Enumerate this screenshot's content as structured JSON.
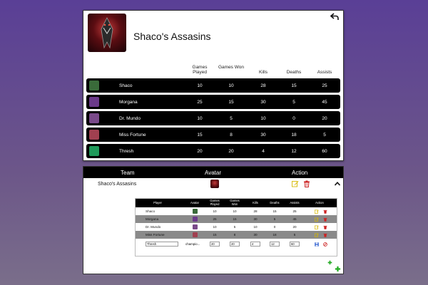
{
  "team": {
    "name": "Shaco's Assasins",
    "stat_headers": {
      "games_played": "Games Played",
      "games_won": "Games Won",
      "kills": "Kills",
      "deaths": "Deaths",
      "assists": "Assists"
    },
    "players": [
      {
        "name": "Shaco",
        "played": "10",
        "won": "10",
        "kills": "28",
        "deaths": "15",
        "assists": "25",
        "color": "#3a6b3a"
      },
      {
        "name": "Morgana",
        "played": "25",
        "won": "15",
        "kills": "30",
        "deaths": "5",
        "assists": "45",
        "color": "#6b3a8a"
      },
      {
        "name": "Dr. Mundo",
        "played": "10",
        "won": "5",
        "kills": "10",
        "deaths": "0",
        "assists": "20",
        "color": "#7a4a8a"
      },
      {
        "name": "Miss Fortune",
        "played": "15",
        "won": "8",
        "kills": "30",
        "deaths": "18",
        "assists": "5",
        "color": "#a04050"
      },
      {
        "name": "Thresh",
        "played": "20",
        "won": "20",
        "kills": "4",
        "deaths": "12",
        "assists": "60",
        "color": "#1f9a5a"
      }
    ]
  },
  "admin": {
    "headers": {
      "team": "Team",
      "avatar": "Avatar",
      "action": "Action"
    },
    "team_name": "Shaco's Assasins",
    "inner_headers": {
      "player": "Player",
      "avatar": "Avatar",
      "games_played": "Games Played",
      "games_won": "Games Won",
      "kills": "Kills",
      "deaths": "Deaths",
      "assists": "Assists",
      "action": "Action"
    },
    "rows": [
      {
        "name": "Shaco",
        "played": "10",
        "won": "10",
        "kills": "28",
        "deaths": "15",
        "assists": "25"
      },
      {
        "name": "Morgana",
        "played": "25",
        "won": "15",
        "kills": "30",
        "deaths": "5",
        "assists": "45"
      },
      {
        "name": "Dr. Mundo",
        "played": "10",
        "won": "5",
        "kills": "10",
        "deaths": "0",
        "assists": "20"
      },
      {
        "name": "Miss Fortune",
        "played": "15",
        "won": "8",
        "kills": "30",
        "deaths": "18",
        "assists": "5"
      }
    ],
    "edit_row": {
      "name": "Thresh",
      "avatar": "champio...",
      "played": "20",
      "won": "20",
      "kills": "4",
      "deaths": "12",
      "assists": "60"
    }
  },
  "colors": {
    "edit": "#d6b800",
    "delete": "#cc2222",
    "add": "#22aa22",
    "save": "#2255cc"
  },
  "icons": [
    "back-arrow-icon",
    "edit-icon",
    "trash-icon",
    "chevron-up-icon",
    "plus-icon",
    "save-icon",
    "cancel-icon"
  ]
}
